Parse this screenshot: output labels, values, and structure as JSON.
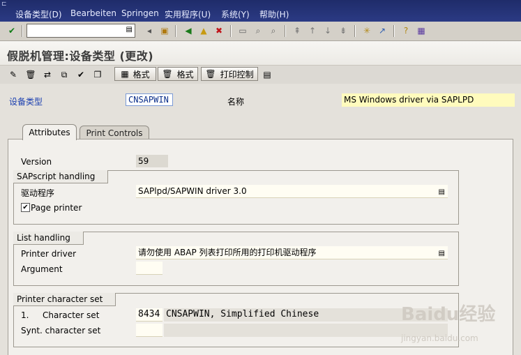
{
  "menu": {
    "items": [
      "设备类型(D)",
      "Bearbeiten",
      "Springen",
      "实用程序(U)",
      "系统(Y)",
      "帮助(H)"
    ]
  },
  "toolbar": {
    "command_value": ""
  },
  "page": {
    "title": "假脱机管理:设备类型 (更改)"
  },
  "app_toolbar": {
    "format_label_1": "格式",
    "format_label_2": "格式",
    "print_control_label": "打印控制"
  },
  "header": {
    "device_type_label": "设备类型",
    "device_type_value": "CNSAPWIN",
    "name_label": "名称",
    "name_value": "MS Windows driver via SAPLPD"
  },
  "tabs": [
    {
      "label": "Attributes",
      "active": true
    },
    {
      "label": "Print Controls",
      "active": false
    }
  ],
  "attributes": {
    "version_label": "Version",
    "version_value": "59",
    "sapscript_group": {
      "title": "SAPscript handling",
      "driver_label": "驱动程序",
      "driver_value": "SAPlpd/SAPWIN driver 3.0",
      "page_printer_label": "Page printer",
      "page_printer_checked": true
    },
    "list_group": {
      "title": "List handling",
      "printer_driver_label": "Printer driver",
      "printer_driver_value": "请勿使用 ABAP 列表打印所用的打印机驱动程序",
      "argument_label": "Argument",
      "argument_value": ""
    },
    "charset_group": {
      "title": "Printer character set",
      "row_number": "1.",
      "charset_label": "Character set",
      "charset_code": "8434",
      "charset_desc": "CNSAPWIN, Simplified Chinese",
      "synt_label": "Synt. character set",
      "synt_value": ""
    }
  },
  "watermark": {
    "brand": "Baidu经验",
    "url": "jingyan.baidu.com"
  }
}
